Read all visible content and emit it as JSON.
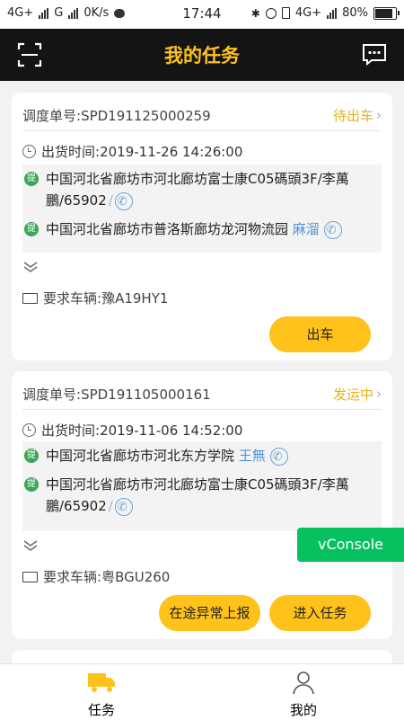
{
  "statusbar": {
    "left": "4G+ G 0K/s",
    "net1": "4G+",
    "net2": "G",
    "speed": "0K/s",
    "time": "17:44",
    "right_net": "4G+",
    "battery": "80%",
    "battery_level": 0.8
  },
  "header": {
    "title": "我的任务"
  },
  "orders": [
    {
      "dispatch_label": "调度单号:",
      "dispatch_no": "SPD191125000259",
      "status": "待出车",
      "ship_time_label": "出货时间:",
      "ship_time": "2019-11-26 14:26:00",
      "stops": [
        {
          "badge": "提",
          "address": "中国河北省廊坊市河北廊坊富士康C05碼頭3F/李萬鵬/65902",
          "contact": ""
        },
        {
          "badge": "提",
          "address": "中国河北省廊坊市普洛斯廊坊龙河物流园",
          "contact": "麻溜"
        }
      ],
      "vehicle_label": "要求车辆:",
      "vehicle": "豫A19HY1",
      "buttons": [
        "出车"
      ]
    },
    {
      "dispatch_label": "调度单号:",
      "dispatch_no": "SPD191105000161",
      "status": "发运中",
      "ship_time_label": "出货时间:",
      "ship_time": "2019-11-06 14:52:00",
      "stops": [
        {
          "badge": "提",
          "address": "中国河北省廊坊市河北东方学院",
          "contact": "王無"
        },
        {
          "badge": "提",
          "address": "中国河北省廊坊市河北廊坊富士康C05碼頭3F/李萬鵬/65902",
          "contact": ""
        }
      ],
      "vehicle_label": "要求车辆:",
      "vehicle": "粤BGU260",
      "buttons": [
        "在途异常上报",
        "进入任务"
      ]
    }
  ],
  "vconsole": "vConsole",
  "tabs": [
    {
      "label": "任务"
    },
    {
      "label": "我的"
    }
  ],
  "colors": {
    "accent": "#ffc21a",
    "header_bg": "#141414",
    "badge_green": "#3aa655",
    "vconsole": "#07c160"
  }
}
